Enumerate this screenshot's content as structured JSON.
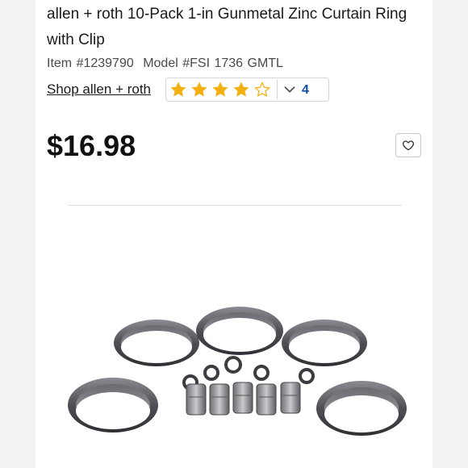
{
  "product": {
    "title": "allen + roth 10-Pack 1-in Gunmetal Zinc Curtain Ring with Clip",
    "item_number": "Item #1239790",
    "model_number": "Model #FSI 1736 GMTL",
    "brand_link": "Shop allen + roth",
    "rating": {
      "value": 4,
      "max": 5,
      "review_count": "4"
    },
    "price": "$16.98",
    "image_icon": "curtain-rings-with-clips-photo"
  },
  "colors": {
    "star_filled": "#f3b013",
    "star_empty": "#f3b013",
    "link_blue": "#0e4da4",
    "ring_metal": "#5a5b5f"
  },
  "icons": {
    "favorite": "heart-icon",
    "expand": "chevron-down-icon"
  }
}
